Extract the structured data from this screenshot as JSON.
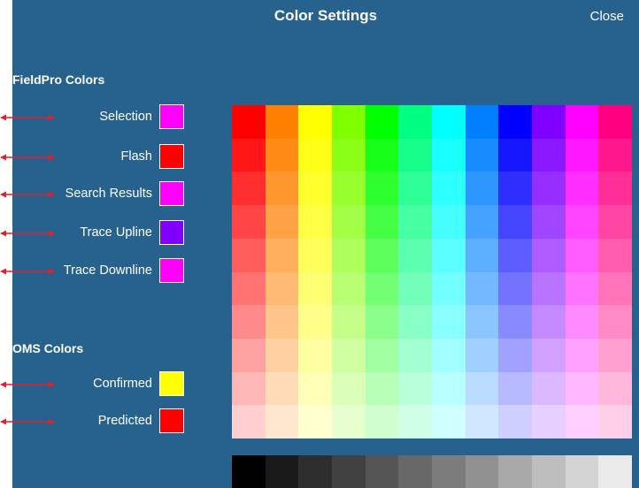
{
  "header": {
    "title": "Color Settings",
    "close_label": "Close"
  },
  "fieldpro": {
    "heading": "FieldPro Colors",
    "items": [
      {
        "label": "Selection",
        "color": "#ff00ff"
      },
      {
        "label": "Flash",
        "color": "#ff0000"
      },
      {
        "label": "Search Results",
        "color": "#ff00ff"
      },
      {
        "label": "Trace Upline",
        "color": "#8000ff"
      },
      {
        "label": "Trace Downline",
        "color": "#ff00ff"
      }
    ]
  },
  "oms": {
    "heading": "OMS Colors",
    "items": [
      {
        "label": "Confirmed",
        "color": "#ffff00"
      },
      {
        "label": "Predicted",
        "color": "#ff0000"
      }
    ]
  },
  "palette": {
    "hues": [
      "#ff0000",
      "#ff8000",
      "#ffff00",
      "#80ff00",
      "#00ff00",
      "#00ff80",
      "#00ffff",
      "#0080ff",
      "#0000ff",
      "#8000ff",
      "#ff00ff",
      "#ff0080"
    ],
    "grays": [
      "#000000",
      "#1a1a1a",
      "#2e2e2e",
      "#414141",
      "#555555",
      "#686868",
      "#7c7c7c",
      "#919191",
      "#a8a8a8",
      "#bebebe",
      "#d4d4d4",
      "#eaeaea"
    ]
  },
  "annotation_color": "#e0202a"
}
